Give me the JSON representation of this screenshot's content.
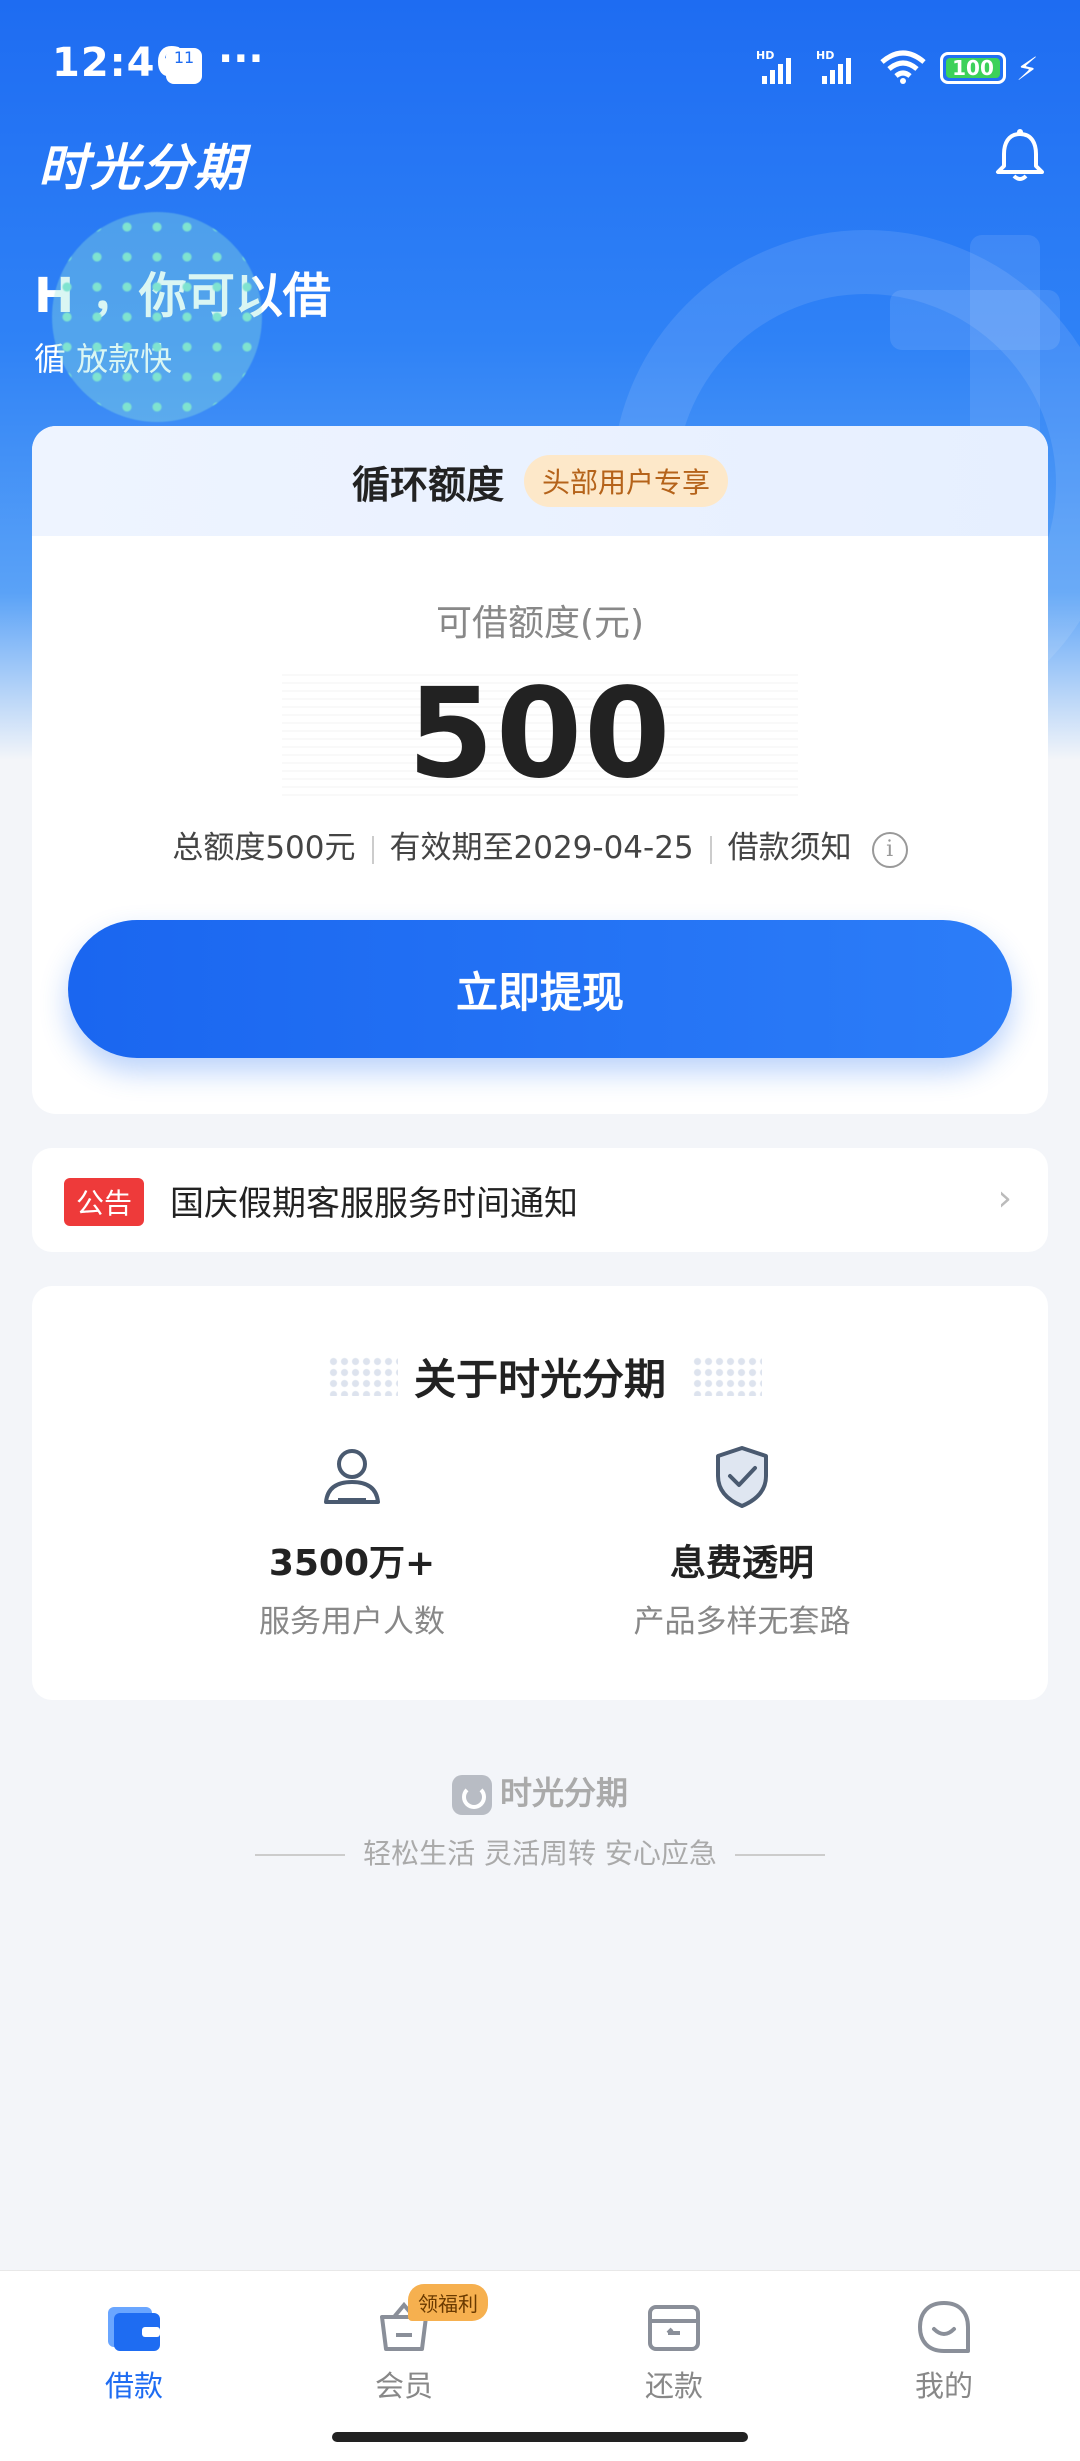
{
  "status_bar": {
    "time": "12:46",
    "badge": "11",
    "more": "···",
    "battery": "100",
    "network": "HD"
  },
  "header": {
    "app_title": "时光分期"
  },
  "greeting": {
    "title": "H     ，你可以借",
    "subtitle": "循        放款快"
  },
  "credit_card": {
    "title": "循环额度",
    "tag": "头部用户专享",
    "available_label": "可借额度(元)",
    "amount": "500",
    "total": "总额度500元",
    "valid": "有效期至2029-04-25",
    "notice_link": "借款须知",
    "withdraw_label": "立即提现"
  },
  "notice": {
    "tag": "公告",
    "text": "国庆假期客服服务时间通知"
  },
  "about": {
    "title": "关于时光分期",
    "features": [
      {
        "icon": "user-icon",
        "value": "3500万+",
        "sub": "服务用户人数"
      },
      {
        "icon": "shield-check-icon",
        "value": "息费透明",
        "sub": "产品多样无套路"
      }
    ]
  },
  "footer": {
    "brand": "时光分期",
    "slogan": "轻松生活 灵活周转 安心应急"
  },
  "tabbar": {
    "tabs": [
      {
        "label": "借款",
        "icon": "wallet-icon",
        "active": true
      },
      {
        "label": "会员",
        "icon": "basket-icon",
        "active": false
      },
      {
        "label": "还款",
        "icon": "card-icon",
        "active": false
      },
      {
        "label": "我的",
        "icon": "smile-icon",
        "active": false
      }
    ],
    "welfare_badge": "领福利"
  },
  "colors": {
    "primary": "#1e6cf2",
    "notice_red": "#ee3a3a",
    "tag_bg": "#fde8c9",
    "tag_text": "#b5631a"
  }
}
